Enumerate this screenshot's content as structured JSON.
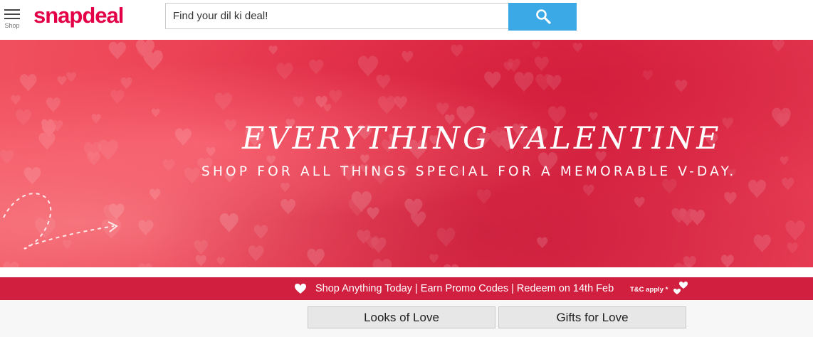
{
  "header": {
    "menu_label": "Shop",
    "logo_text": "snapdeal",
    "search_placeholder": "Find your dil ki deal!",
    "search_icon": "search-icon"
  },
  "banner": {
    "title": "EVERYTHING VALENTINE",
    "subtitle": "SHOP FOR ALL THINGS SPECIAL FOR A MEMORABLE V-DAY."
  },
  "promo": {
    "text": "Shop Anything Today | Earn Promo Codes | Redeem on 14th Feb",
    "tc": "T&C apply *"
  },
  "buttons": {
    "looks": "Looks of Love",
    "gifts": "Gifts for Love"
  },
  "colors": {
    "brand": "#e40046",
    "search_button": "#3aa9e6",
    "promo_strip": "#d11f3f"
  }
}
